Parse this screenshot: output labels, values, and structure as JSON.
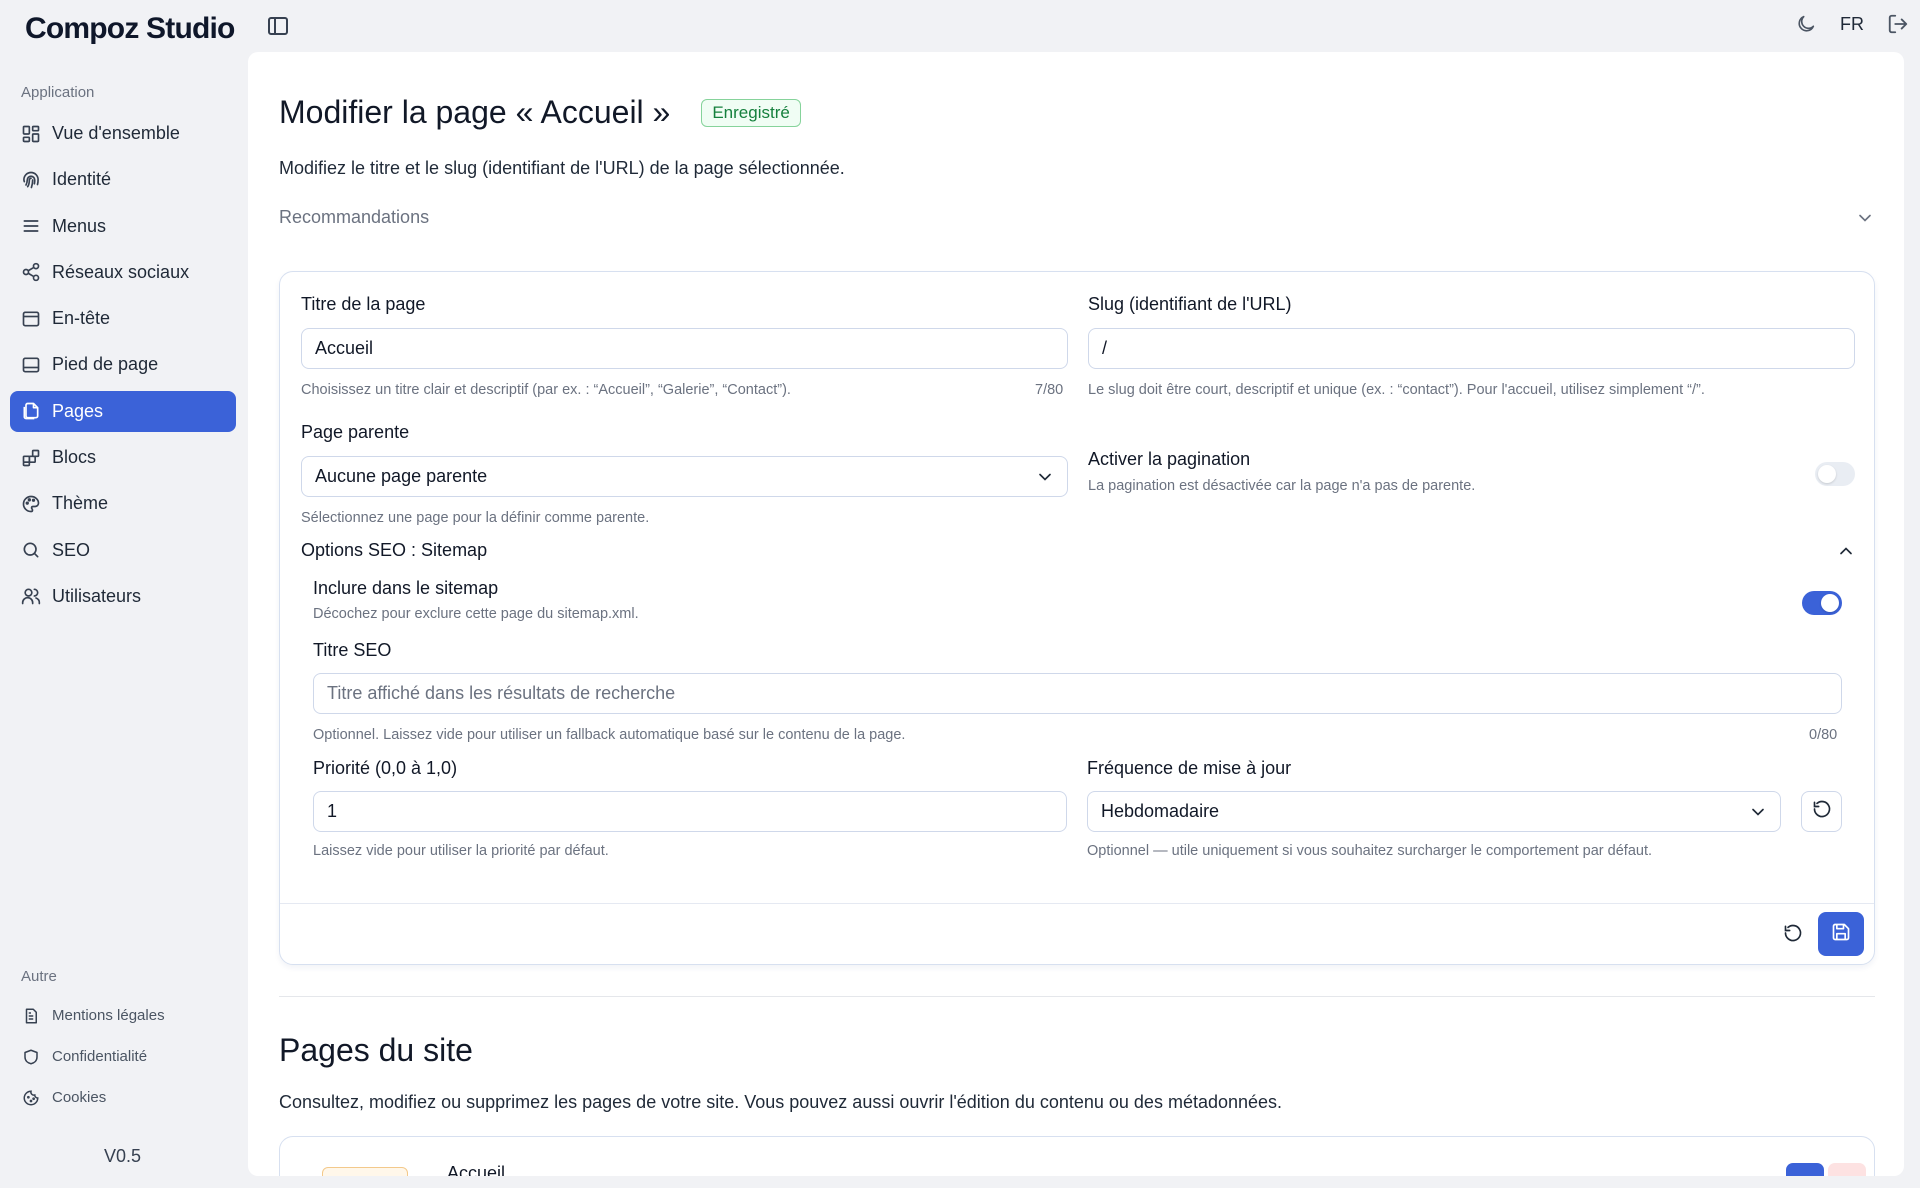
{
  "app": {
    "brand": "Compoz Studio",
    "version": "V0.5",
    "lang": "FR"
  },
  "sidebar": {
    "section_app": "Application",
    "items": [
      {
        "label": "Vue d'ensemble",
        "icon": "grid-icon"
      },
      {
        "label": "Identité",
        "icon": "fingerprint-icon"
      },
      {
        "label": "Menus",
        "icon": "menu-icon"
      },
      {
        "label": "Réseaux sociaux",
        "icon": "share-icon"
      },
      {
        "label": "En-tête",
        "icon": "header-icon"
      },
      {
        "label": "Pied de page",
        "icon": "footer-icon"
      },
      {
        "label": "Pages",
        "icon": "pages-icon"
      },
      {
        "label": "Blocs",
        "icon": "blocks-icon"
      },
      {
        "label": "Thème",
        "icon": "palette-icon"
      },
      {
        "label": "SEO",
        "icon": "search-icon"
      },
      {
        "label": "Utilisateurs",
        "icon": "users-icon"
      }
    ],
    "active": "Pages",
    "section_other": "Autre",
    "other_items": [
      {
        "label": "Mentions légales",
        "icon": "file-text-icon"
      },
      {
        "label": "Confidentialité",
        "icon": "shield-icon"
      },
      {
        "label": "Cookies",
        "icon": "cookie-icon"
      }
    ]
  },
  "header": {
    "title": "Modifier la page « Accueil »",
    "badge": "Enregistré",
    "description": "Modifiez le titre et le slug (identifiant de l'URL) de la page sélectionnée.",
    "recommendations": "Recommandations"
  },
  "form": {
    "title_label": "Titre de la page",
    "title_value": "Accueil",
    "title_help": "Choisissez un titre clair et descriptif (par ex. : “Accueil”, “Galerie”, “Contact”).",
    "title_count": "7/80",
    "slug_label": "Slug (identifiant de l'URL)",
    "slug_value": "/",
    "slug_help": "Le slug doit être court, descriptif et unique (ex. : “contact”). Pour l'accueil, utilisez simplement “/”.",
    "parent_label": "Page parente",
    "parent_value": "Aucune page parente",
    "parent_help": "Sélectionnez une page pour la définir comme parente.",
    "pagination_label": "Activer la pagination",
    "pagination_help": "La pagination est désactivée car la page n'a pas de parente.",
    "pagination_enabled": false,
    "seo_section": "Options SEO : Sitemap",
    "sitemap_label": "Inclure dans le sitemap",
    "sitemap_help": "Décochez pour exclure cette page du sitemap.xml.",
    "sitemap_enabled": true,
    "seo_title_label": "Titre SEO",
    "seo_title_placeholder": "Titre affiché dans les résultats de recherche",
    "seo_title_help": "Optionnel. Laissez vide pour utiliser un fallback automatique basé sur le contenu de la page.",
    "seo_title_count": "0/80",
    "priority_label": "Priorité (0,0 à 1,0)",
    "priority_value": "1",
    "priority_help": "Laissez vide pour utiliser la priorité par défaut.",
    "freq_label": "Fréquence de mise à jour",
    "freq_value": "Hebdomadaire",
    "freq_help": "Optionnel — utile uniquement si vous souhaitez surcharger le comportement par défaut."
  },
  "pages_section": {
    "title": "Pages du site",
    "description": "Consultez, modifiez ou supprimez les pages de votre site. Vous pouvez aussi ouvrir l'édition du contenu ou des métadonnées.",
    "rows": [
      {
        "title": "Accueil"
      }
    ]
  },
  "colors": {
    "accent": "#3b62d8",
    "success": "#15803d",
    "border": "#cfd8ea"
  }
}
